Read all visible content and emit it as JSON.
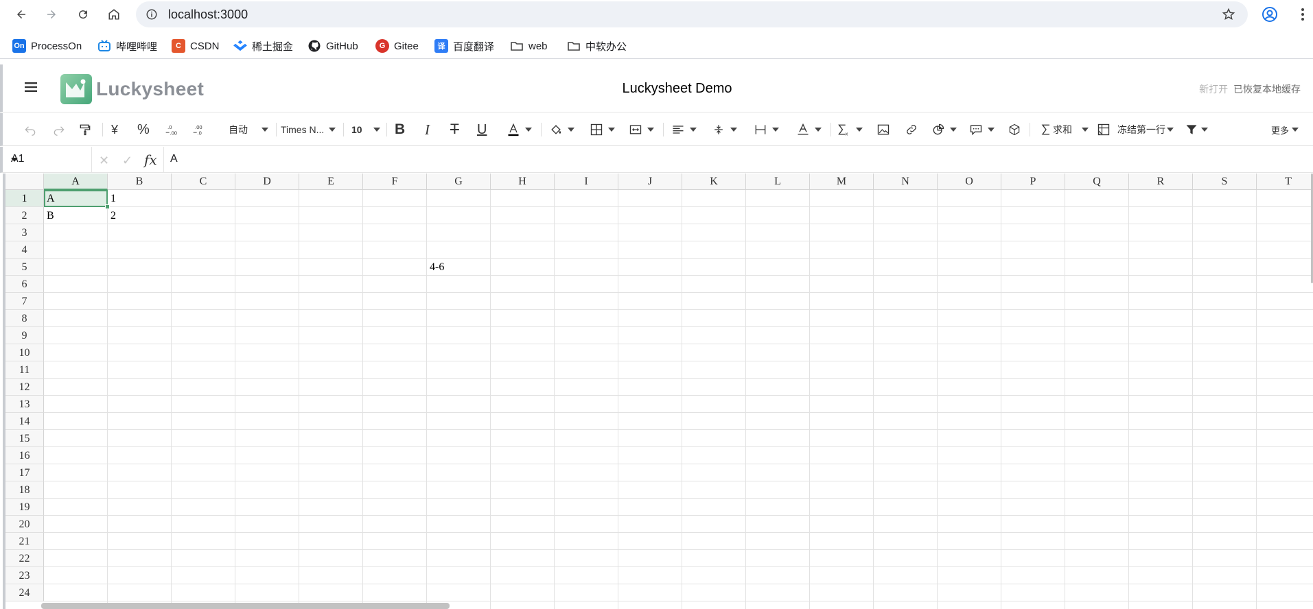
{
  "browser": {
    "url": "localhost:3000",
    "bookmarks": [
      {
        "label": "ProcessOn",
        "icon": "processon-icon",
        "badge": "On",
        "color": "#1a73e8"
      },
      {
        "label": "哔哩哔哩",
        "icon": "bilibili-icon",
        "badge": "",
        "color": "#1e88e5"
      },
      {
        "label": "CSDN",
        "icon": "csdn-icon",
        "badge": "C",
        "color": "#e4572e"
      },
      {
        "label": "稀土掘金",
        "icon": "juejin-icon",
        "badge": "",
        "color": "#1e80ff"
      },
      {
        "label": "GitHub",
        "icon": "github-icon",
        "badge": "",
        "color": "#202124"
      },
      {
        "label": "Gitee",
        "icon": "gitee-icon",
        "badge": "G",
        "color": "#d9342b"
      },
      {
        "label": "百度翻译",
        "icon": "baidu-translate-icon",
        "badge": "译",
        "color": "#2f7df6"
      },
      {
        "label": "web",
        "icon": "folder-icon",
        "badge": "",
        "color": "#444"
      },
      {
        "label": "中软办公",
        "icon": "folder-icon",
        "badge": "",
        "color": "#444"
      }
    ]
  },
  "header": {
    "logo_text": "Luckysheet",
    "title": "Luckysheet Demo",
    "status_new": "新打开",
    "status_restored": "已恢复本地缓存"
  },
  "toolbar": {
    "format_label": "自动",
    "font_label": "Times N...",
    "size_label": "10",
    "sum_label": "求和",
    "freeze_label": "冻结第一行",
    "more_label": "更多",
    "currency_label": "¥",
    "percent_label": "%",
    "accent_color": "#4e9f6f"
  },
  "formula_bar": {
    "cell_ref": "A1",
    "fx_label": "fx",
    "content": "A"
  },
  "sheet": {
    "columns": [
      "A",
      "B",
      "C",
      "D",
      "E",
      "F",
      "G",
      "H",
      "I",
      "J",
      "K",
      "L",
      "M",
      "N",
      "O",
      "P",
      "Q",
      "R",
      "S",
      "T"
    ],
    "rows": [
      "1",
      "2",
      "3",
      "4",
      "5",
      "6",
      "7",
      "8",
      "9",
      "10",
      "11",
      "12",
      "13",
      "14",
      "15",
      "16",
      "17",
      "18",
      "19",
      "20",
      "21",
      "22",
      "23",
      "24"
    ],
    "cells": [
      {
        "ref": "A1",
        "value": "A"
      },
      {
        "ref": "B1",
        "value": "1"
      },
      {
        "ref": "A2",
        "value": "B"
      },
      {
        "ref": "B2",
        "value": "2"
      },
      {
        "ref": "G5",
        "value": "4-6"
      }
    ]
  }
}
